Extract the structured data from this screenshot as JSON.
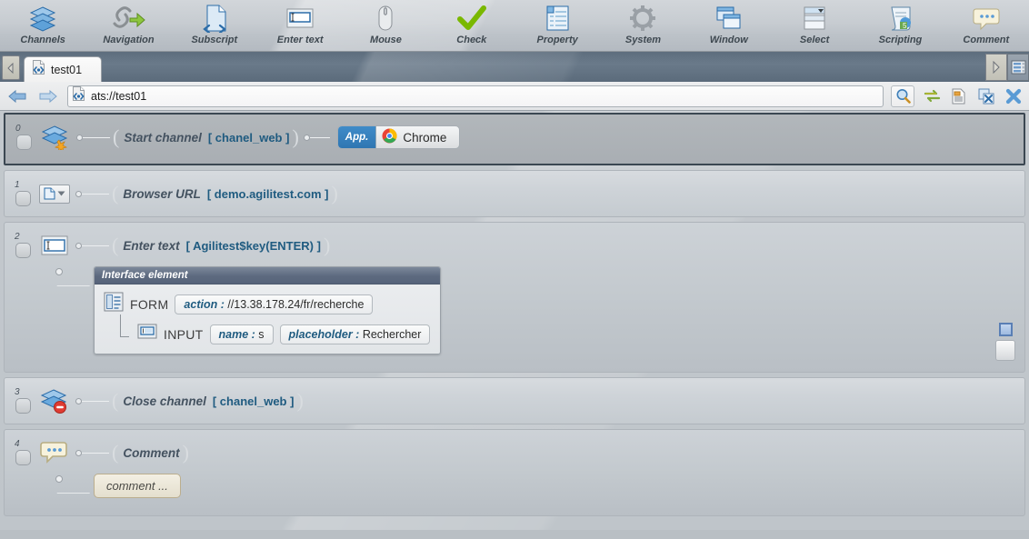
{
  "toolbar": {
    "items": [
      {
        "label": "Channels",
        "icon": "channels-icon"
      },
      {
        "label": "Navigation",
        "icon": "navigation-icon"
      },
      {
        "label": "Subscript",
        "icon": "subscript-icon"
      },
      {
        "label": "Enter text",
        "icon": "enter-text-icon"
      },
      {
        "label": "Mouse",
        "icon": "mouse-icon"
      },
      {
        "label": "Check",
        "icon": "check-icon"
      },
      {
        "label": "Property",
        "icon": "property-icon"
      },
      {
        "label": "System",
        "icon": "system-gear-icon"
      },
      {
        "label": "Window",
        "icon": "window-icon"
      },
      {
        "label": "Select",
        "icon": "select-icon"
      },
      {
        "label": "Scripting",
        "icon": "scripting-icon"
      },
      {
        "label": "Comment",
        "icon": "comment-icon"
      }
    ]
  },
  "tabbar": {
    "prev_label": "◁",
    "tab": {
      "title": "test01",
      "icon": "ats-file-icon"
    },
    "right_buttons": [
      {
        "name": "next-arrow-button",
        "glyph": "▷"
      },
      {
        "name": "panel-list-button",
        "glyph": "list"
      }
    ]
  },
  "urlbar": {
    "back": "⇦",
    "forward": "⇨",
    "value": "ats://test01",
    "placeholder": "ats://",
    "icons": [
      {
        "name": "search-icon"
      },
      {
        "name": "sync-icon"
      },
      {
        "name": "report-icon"
      },
      {
        "name": "excel-export-icon"
      },
      {
        "name": "close-all-icon"
      }
    ]
  },
  "steps": [
    {
      "index": "0",
      "selected": true,
      "icon": "start-channel-icon",
      "action": "Start channel",
      "param": "[ chanel_web ]",
      "chip": {
        "badge": "App.",
        "name": "Chrome",
        "icon": "chrome-icon"
      }
    },
    {
      "index": "1",
      "selected": false,
      "icon": "browser-url-combo-icon",
      "action": "Browser URL",
      "param": "[ demo.agilitest.com ]"
    },
    {
      "index": "2",
      "selected": false,
      "icon": "enter-text-icon",
      "action": "Enter text",
      "param": "[ Agilitest$key(ENTER) ]",
      "panel": {
        "title": "Interface element",
        "nodes": [
          {
            "tag": "FORM",
            "icon": "form-icon",
            "attrs": [
              {
                "key": "action :",
                "value": "//13.38.178.24/fr/recherche"
              }
            ]
          },
          {
            "tag": "INPUT",
            "icon": "input-icon",
            "attrs": [
              {
                "key": "name :",
                "value": "s"
              },
              {
                "key": "placeholder :",
                "value": "Rechercher"
              }
            ]
          }
        ]
      }
    },
    {
      "index": "3",
      "selected": false,
      "icon": "close-channel-icon",
      "action": "Close channel",
      "param": "[ chanel_web ]"
    },
    {
      "index": "4",
      "selected": false,
      "icon": "comment-icon",
      "action": "Comment",
      "param": "",
      "comment": "comment ..."
    }
  ]
}
